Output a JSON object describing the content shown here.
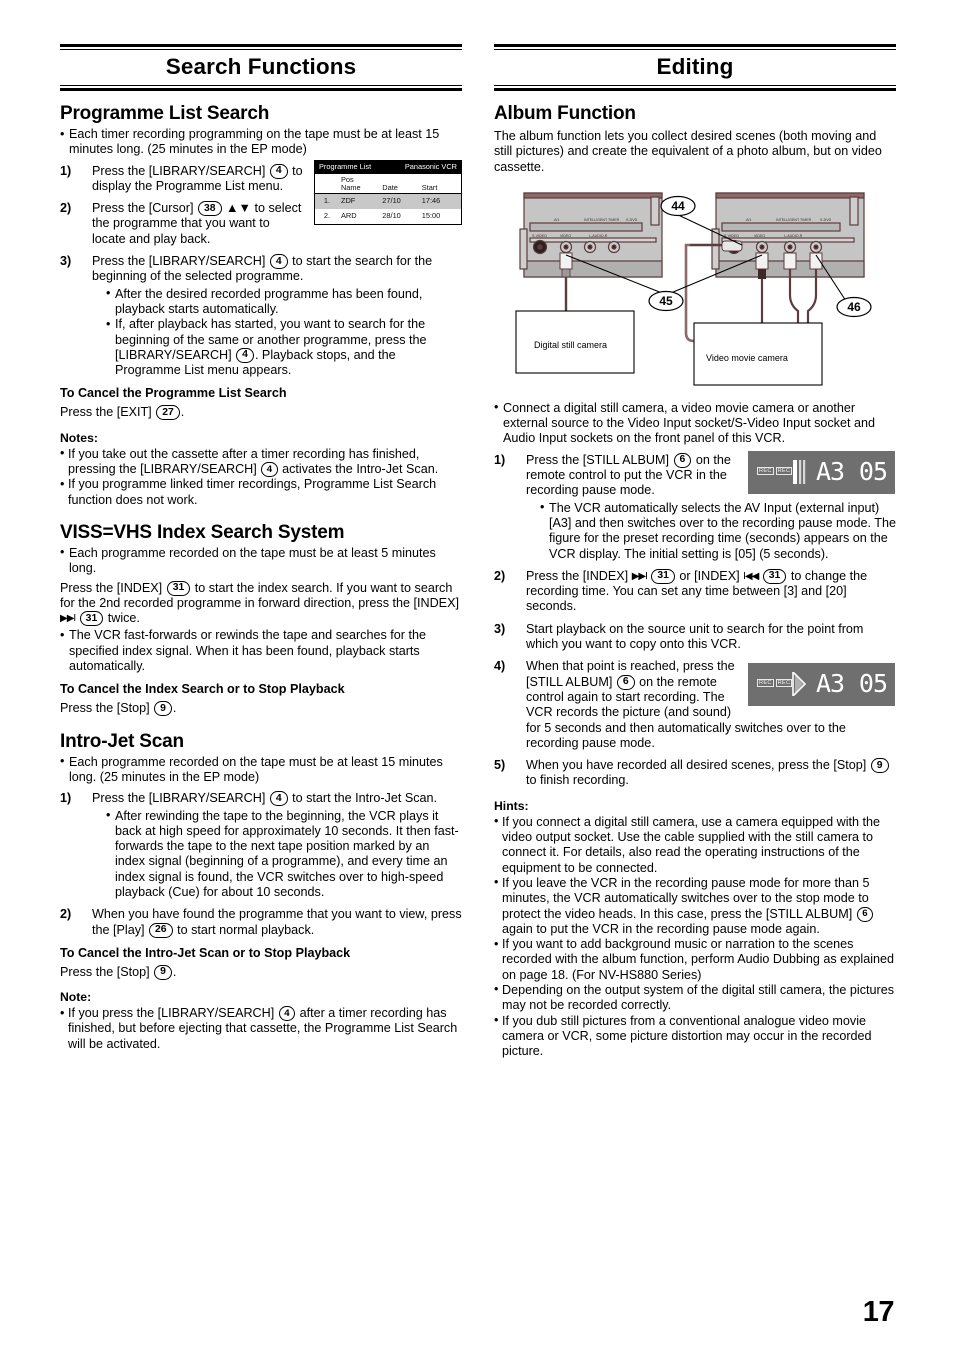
{
  "page": {
    "number": "17"
  },
  "left": {
    "banner_title": "Search Functions",
    "s1": {
      "heading": "Programme List Search",
      "intro": "Each timer recording programming on the tape must be at least 15 minutes long. (25 minutes in the EP mode)",
      "steps": [
        {
          "num": "1)",
          "a": "Press the [LIBRARY/SEARCH]",
          "key": "4",
          "b": "to display the Programme List menu."
        },
        {
          "num": "2)",
          "a": "Press the [Cursor]",
          "key": "38",
          "b": "▲▼ to select the programme that you want to locate and play back."
        },
        {
          "num": "3)",
          "a": "Press the [LIBRARY/SEARCH]",
          "key": "4",
          "b": "to start the search for the beginning of the selected programme."
        }
      ],
      "step3_bullets": [
        "After the desired recorded programme has been found, playback starts automatically.",
        "If, after playback has started, you want to search for the beginning of the same or another programme, press the [LIBRARY/SEARCH]"
      ],
      "step3_b2_key": "4",
      "step3_b2_tail": ". Playback stops, and the Programme List menu appears.",
      "cancel_head": "To Cancel the Programme List Search",
      "cancel_text": "Press the [EXIT]",
      "cancel_key": "27",
      "cancel_tail": ".",
      "notes_head": "Notes:",
      "note1_a": "If you take out the cassette after a timer recording has finished, pressing the [LIBRARY/SEARCH]",
      "note1_key": "4",
      "note1_b": "activates the Intro-Jet Scan.",
      "note2": "If you programme linked timer recordings, Programme List Search function does not work."
    },
    "prog_screen": {
      "title": "Programme List",
      "brand": "Panasonic VCR",
      "col_pos": "Pos",
      "col_name": "Name",
      "col_date": "Date",
      "col_start": "Start",
      "rows": [
        {
          "pos": "1.",
          "name": "ZDF",
          "date": "27/10",
          "start": "17:46"
        },
        {
          "pos": "2.",
          "name": "ARD",
          "date": "28/10",
          "start": "15:00"
        }
      ]
    },
    "s2": {
      "heading": "VISS=VHS Index Search System",
      "intro": "Each programme recorded on the tape must be at least 5 minutes long.",
      "p1_a": "Press the [INDEX]",
      "p1_key1": "31",
      "p1_b": "to start the index search. If you want to search for the 2nd recorded programme in forward direction, press the [INDEX]",
      "p1_arrow": "▶▶I",
      "p1_key2": "31",
      "p1_c": "twice.",
      "bullet": "The VCR fast-forwards or rewinds the tape and searches for the specified index signal. When it has been found, playback starts automatically.",
      "cancel_head": "To Cancel the Index Search or to Stop Playback",
      "cancel_text": "Press the [Stop]",
      "cancel_key": "9",
      "cancel_tail": "."
    },
    "s3": {
      "heading": "Intro-Jet Scan",
      "intro": "Each programme recorded on the tape must be at least 15 minutes long. (25 minutes in the EP mode)",
      "step1_num": "1)",
      "step1_a": "Press the [LIBRARY/SEARCH]",
      "step1_key": "4",
      "step1_b": "to start the Intro-Jet Scan.",
      "step1_bullet": "After rewinding the tape to the beginning, the VCR plays it back at high speed for approximately 10 seconds. It then fast-forwards the tape to the next tape position marked by an index signal (beginning of a programme), and every time an index signal is found, the VCR switches over to high-speed playback (Cue) for about 10 seconds.",
      "step2_num": "2)",
      "step2_a": "When you have found the programme that you want to view, press the [Play]",
      "step2_key": "26",
      "step2_b": "to start normal playback.",
      "cancel_head": "To Cancel the Intro-Jet Scan or to Stop Playback",
      "cancel_text": "Press the [Stop]",
      "cancel_key": "9",
      "cancel_tail": ".",
      "note_head": "Note:",
      "note_a": "If you press the [LIBRARY/SEARCH]",
      "note_key": "4",
      "note_b": "after a timer recording has finished, but before ejecting that cassette, the Programme List Search will be activated."
    }
  },
  "right": {
    "banner_title": "Editing",
    "album": {
      "heading": "Album Function",
      "intro": "The album function lets you collect desired scenes (both moving and still pictures) and create the equivalent of a photo album, but on video cassette.",
      "diagram": {
        "callout_44": "44",
        "callout_45": "45",
        "callout_46": "46",
        "label_still_camera": "Digital still camera",
        "label_movie_camera": "Video movie camera",
        "panel_labels": [
          "A/1",
          "INTELLIGENT TIMER",
          "S-DVD"
        ],
        "socket_labels": [
          "S-VIDEO",
          "VIDEO",
          "L-AUDIO-R"
        ],
        "colors": {
          "panel_fill": "#c5c5c5",
          "panel_outline": "#5c3c3c",
          "plug_body": "#f2f2f2"
        }
      },
      "bullet_connect": "Connect a digital still camera, a video movie camera or another external source to the Video Input socket/S-Video Input socket and Audio Input sockets on the front panel of this VCR.",
      "steps": [
        {
          "num": "1)",
          "a": "Press the [STILL ALBUM]",
          "key": "6",
          "b": "on the remote control to put the VCR in the recording pause mode.",
          "bullet": "The VCR automatically selects the AV Input (external input) [A3] and then switches over to the recording pause mode. The figure for the preset recording time (seconds) appears on the VCR display. The initial setting is [05] (5 seconds)."
        },
        {
          "num": "2)",
          "a": "Press the [INDEX]",
          "arrow1": "▶▶I",
          "key1": "31",
          "mid": "or [INDEX]",
          "arrow2": "I◀◀",
          "key2": "31",
          "b": "to change the recording time. You can set any time between [3] and [20] seconds."
        },
        {
          "num": "3)",
          "a": "Start playback on the source unit to search for the point from which you want to copy onto this VCR."
        },
        {
          "num": "4)",
          "a": "When that point is reached, press the [STILL ALBUM]",
          "key": "6",
          "b": "on the remote control again to start recording.",
          "c": "The VCR records the picture (and sound) for 5 seconds and then automatically switches over to the recording pause mode."
        },
        {
          "num": "5)",
          "a": "When you have recorded all desired scenes, press the [Stop]",
          "key": "9",
          "b": "to finish recording."
        }
      ],
      "display1": {
        "rec_label": "REC",
        "mode_icon": "pause-icon",
        "input": "A3",
        "seconds": "05"
      },
      "display2": {
        "rec_label": "REC",
        "mode_icon": "play-icon",
        "input": "A3",
        "seconds": "05"
      },
      "hints_head": "Hints:",
      "hints": [
        {
          "text": "If you connect a digital still camera, use a camera equipped with the video output socket. Use the cable supplied with the still camera to connect it. For details, also read the operating instructions of the equipment to be connected."
        },
        {
          "a": "If you leave the VCR in the recording pause mode for more than 5 minutes, the VCR automatically switches over to the stop mode to protect the video heads. In this case, press the [STILL ALBUM]",
          "key": "6",
          "b": "again to put the VCR in the recording pause mode again."
        },
        {
          "text": "If you want to add background music or narration to the scenes recorded with the album function, perform Audio Dubbing as explained on page 18. (For NV-HS880 Series)"
        },
        {
          "text": "Depending on the output system of the digital still camera, the pictures may not be recorded correctly."
        },
        {
          "text": "If you dub still pictures from a conventional analogue video movie camera or VCR, some picture distortion may occur in the recorded picture."
        }
      ]
    }
  }
}
